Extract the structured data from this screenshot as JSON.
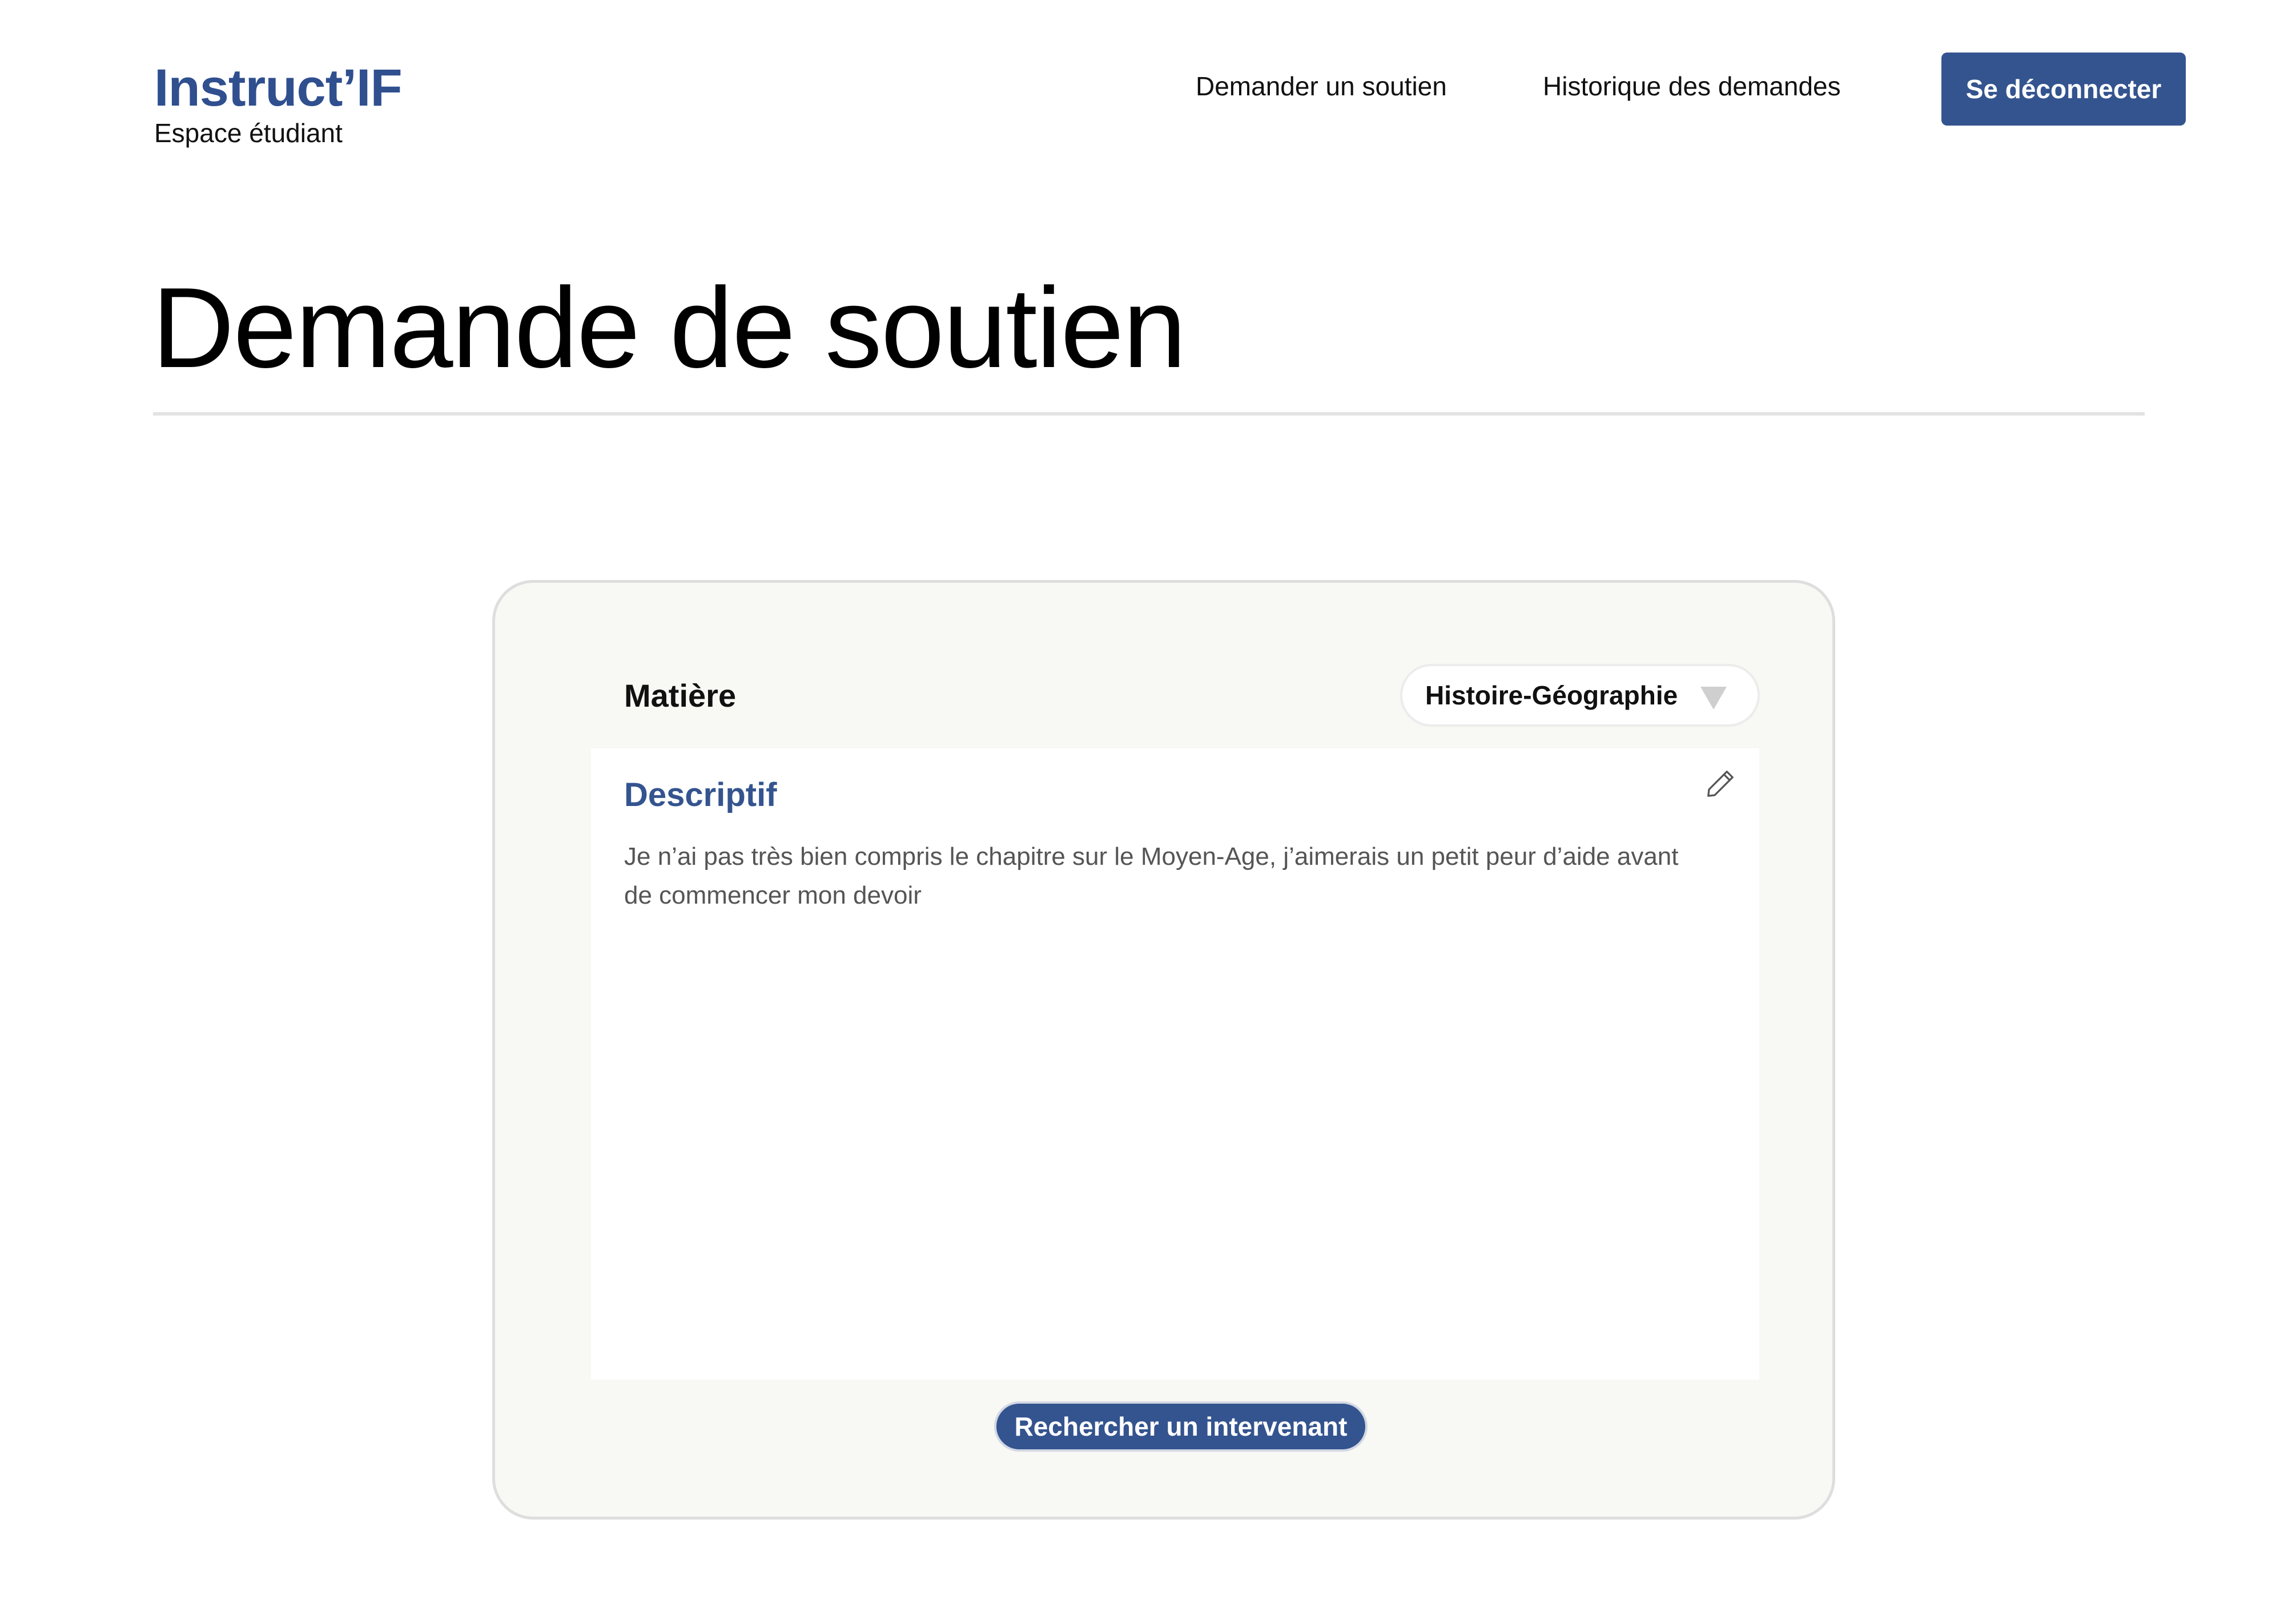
{
  "header": {
    "brand_name": "Instruct’IF",
    "brand_subtitle": "Espace étudiant",
    "nav": [
      {
        "label": "Demander un soutien"
      },
      {
        "label": "Historique des demandes"
      }
    ],
    "logout_label": "Se déconnecter"
  },
  "page": {
    "title": "Demande de soutien"
  },
  "form": {
    "subject_label": "Matière",
    "subject_value": "Histoire-Géographie",
    "description_title": "Descriptif",
    "description_text": "Je n’ai pas très bien compris le chapitre sur le Moyen-Age, j’aimerais un petit peur d’aide avant de commencer mon devoir",
    "submit_label": "Rechercher un intervenant"
  },
  "icons": {
    "select": "chevron-down-icon",
    "edit": "pencil-icon"
  },
  "colors": {
    "brand": "#2f4f8f",
    "primary_button": "#34548f",
    "card_background": "#f8f8f4",
    "card_border": "#dedede",
    "description_text": "#555555"
  }
}
